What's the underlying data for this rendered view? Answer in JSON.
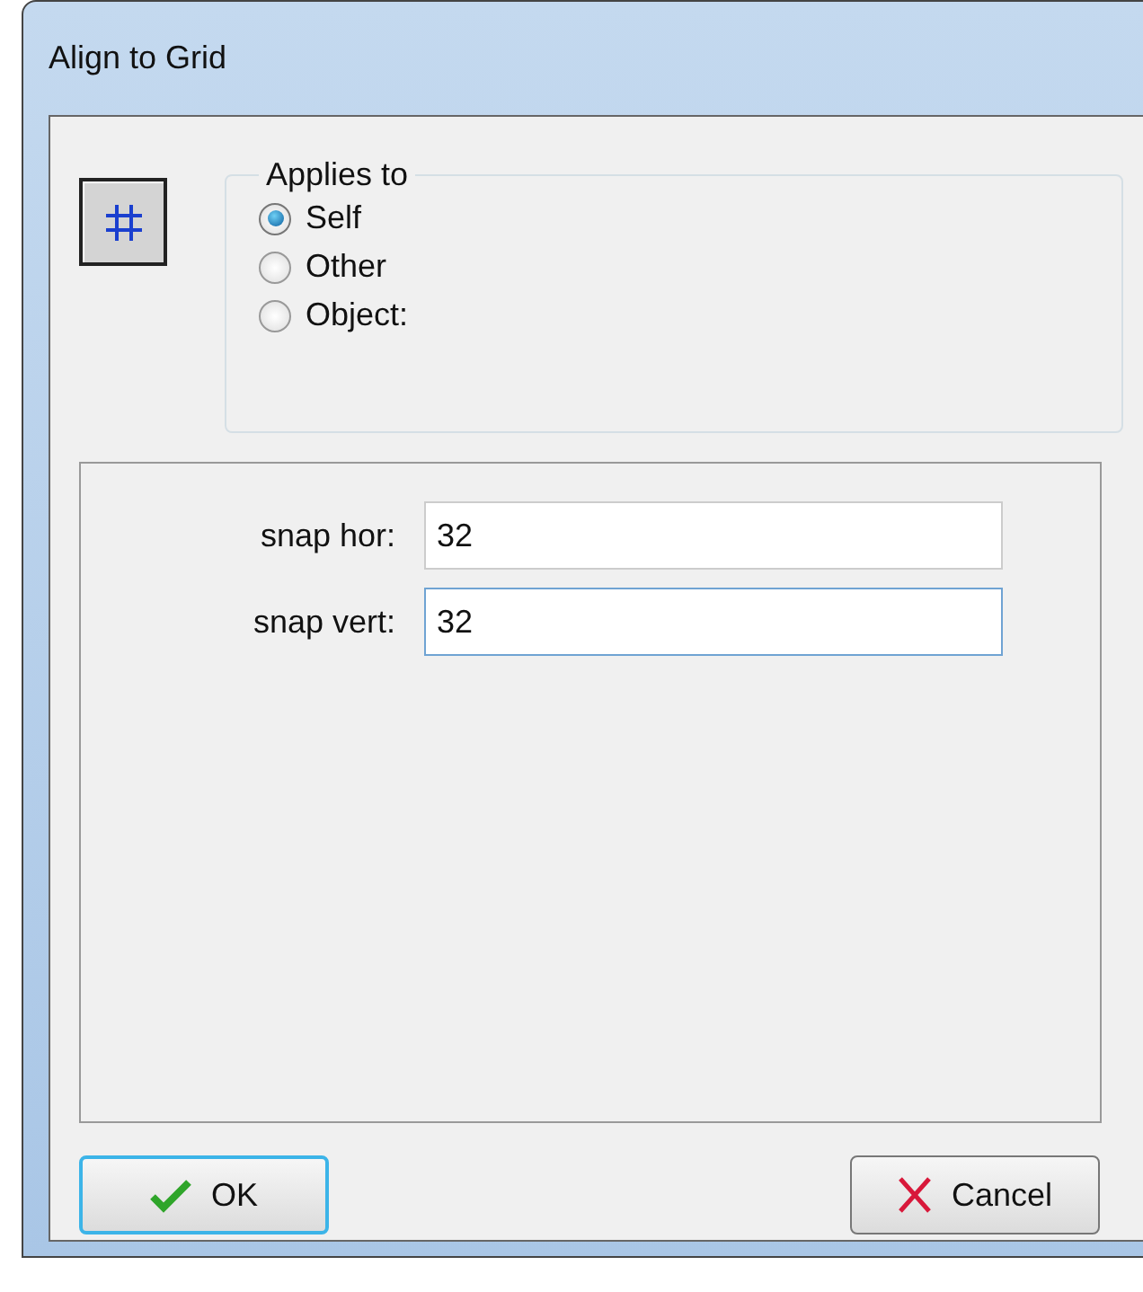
{
  "window": {
    "title": "Align to Grid"
  },
  "applies_to": {
    "label": "Applies to",
    "options": [
      {
        "label": "Self",
        "selected": true
      },
      {
        "label": "Other",
        "selected": false
      },
      {
        "label": "Object:",
        "selected": false
      }
    ]
  },
  "fields": [
    {
      "label": "snap hor:",
      "value": "32",
      "focused": false
    },
    {
      "label": "snap vert:",
      "value": "32",
      "focused": true
    }
  ],
  "buttons": [
    {
      "kind": "ok",
      "label": "OK",
      "default": true
    },
    {
      "kind": "cancel",
      "label": "Cancel",
      "default": false
    }
  ]
}
